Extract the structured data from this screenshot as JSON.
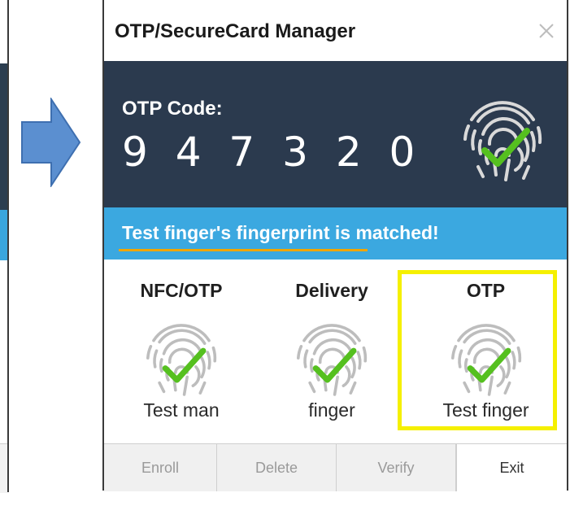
{
  "window": {
    "title": "OTP/SecureCard Manager",
    "close_icon": "close-icon"
  },
  "code": {
    "label": "OTP Code:",
    "value": "9 4 7 3 2 0",
    "icon": "fingerprint-check-icon"
  },
  "status": {
    "message": "Test finger's fingerprint is matched!",
    "underlined_part": "Test finger's fingerprint"
  },
  "profiles": [
    {
      "title": "NFC/OTP",
      "name": "Test man",
      "icon": "fingerprint-check-icon"
    },
    {
      "title": "Delivery",
      "name": "finger",
      "icon": "fingerprint-check-icon"
    },
    {
      "title": "OTP",
      "name": "Test finger",
      "icon": "fingerprint-check-icon",
      "selected": true
    }
  ],
  "footer": {
    "enroll": "Enroll",
    "delete": "Delete",
    "verify": "Verify",
    "exit": "Exit"
  },
  "colors": {
    "dark_panel": "#2b3a4e",
    "status_bar": "#3ba8e0",
    "underline": "#f0a500",
    "highlight": "#f5f000",
    "check": "#55c01f",
    "arrow": "#5b8fd0"
  }
}
